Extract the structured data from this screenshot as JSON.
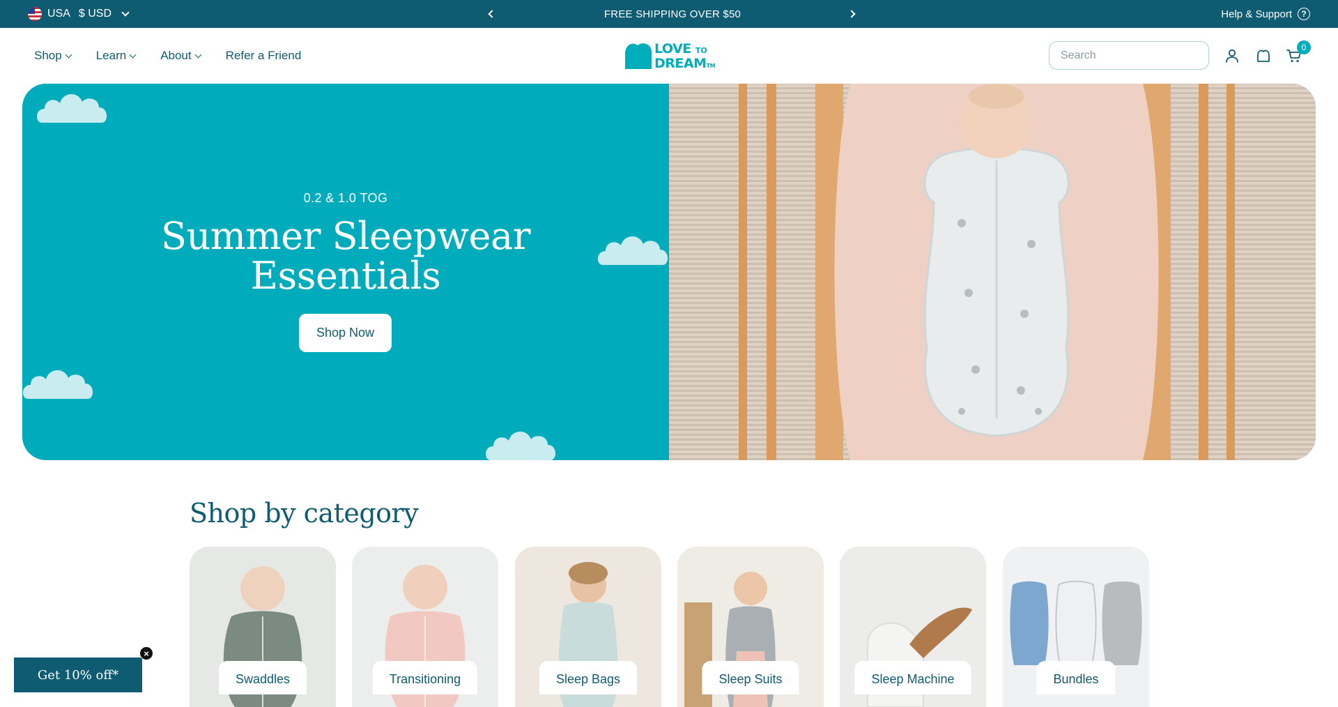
{
  "topbar": {
    "country": "USA",
    "currency": "$ USD",
    "announcement": "FREE SHIPPING OVER $50",
    "help_label": "Help & Support"
  },
  "nav": {
    "items": [
      {
        "label": "Shop",
        "has_dropdown": true
      },
      {
        "label": "Learn",
        "has_dropdown": true
      },
      {
        "label": "About",
        "has_dropdown": true
      },
      {
        "label": "Refer a Friend",
        "has_dropdown": false
      }
    ]
  },
  "logo": {
    "line1": "LOVE",
    "line1_small": "TO",
    "line2": "DREAM",
    "tm": "TM"
  },
  "search": {
    "placeholder": "Search"
  },
  "cart": {
    "count": "0"
  },
  "hero": {
    "subtitle": "0.2 & 1.0 TOG",
    "title_line1": "Summer Sleepwear",
    "title_line2": "Essentials",
    "cta": "Shop Now"
  },
  "categories": {
    "heading": "Shop by category",
    "items": [
      {
        "label": "Swaddles"
      },
      {
        "label": "Transitioning"
      },
      {
        "label": "Sleep Bags"
      },
      {
        "label": "Sleep Suits"
      },
      {
        "label": "Sleep Machine"
      },
      {
        "label": "Bundles"
      }
    ]
  },
  "promo": {
    "label": "Get 10% off*",
    "close": "×"
  },
  "colors": {
    "brand_dark": "#0f5c72",
    "brand_teal": "#00abbb",
    "cloud": "#c8ecef"
  }
}
